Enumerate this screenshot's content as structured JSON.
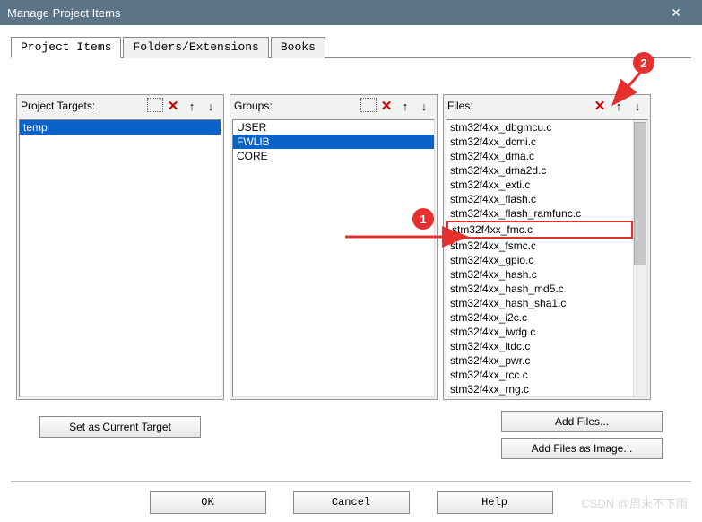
{
  "window": {
    "title": "Manage Project Items"
  },
  "tabs": [
    {
      "label": "Project Items"
    },
    {
      "label": "Folders/Extensions"
    },
    {
      "label": "Books"
    }
  ],
  "active_tab": 0,
  "panels": {
    "targets": {
      "label": "Project Targets:",
      "items": [
        "temp"
      ],
      "selected": 0
    },
    "groups": {
      "label": "Groups:",
      "items": [
        "USER",
        "FWLIB",
        "CORE"
      ],
      "selected": 1
    },
    "files": {
      "label": "Files:",
      "items": [
        "stm32f4xx_dbgmcu.c",
        "stm32f4xx_dcmi.c",
        "stm32f4xx_dma.c",
        "stm32f4xx_dma2d.c",
        "stm32f4xx_exti.c",
        "stm32f4xx_flash.c",
        "stm32f4xx_flash_ramfunc.c",
        "stm32f4xx_fmc.c",
        "stm32f4xx_fsmc.c",
        "stm32f4xx_gpio.c",
        "stm32f4xx_hash.c",
        "stm32f4xx_hash_md5.c",
        "stm32f4xx_hash_sha1.c",
        "stm32f4xx_i2c.c",
        "stm32f4xx_iwdg.c",
        "stm32f4xx_ltdc.c",
        "stm32f4xx_pwr.c",
        "stm32f4xx_rcc.c",
        "stm32f4xx_rng.c"
      ],
      "highlighted": 7
    }
  },
  "buttons": {
    "set_current_target": "Set as Current Target",
    "add_files": "Add Files...",
    "add_files_image": "Add Files as Image...",
    "ok": "OK",
    "cancel": "Cancel",
    "help": "Help"
  },
  "annotations": {
    "marker1": "1",
    "marker2": "2"
  },
  "watermark": "CSDN @周末不下雨"
}
